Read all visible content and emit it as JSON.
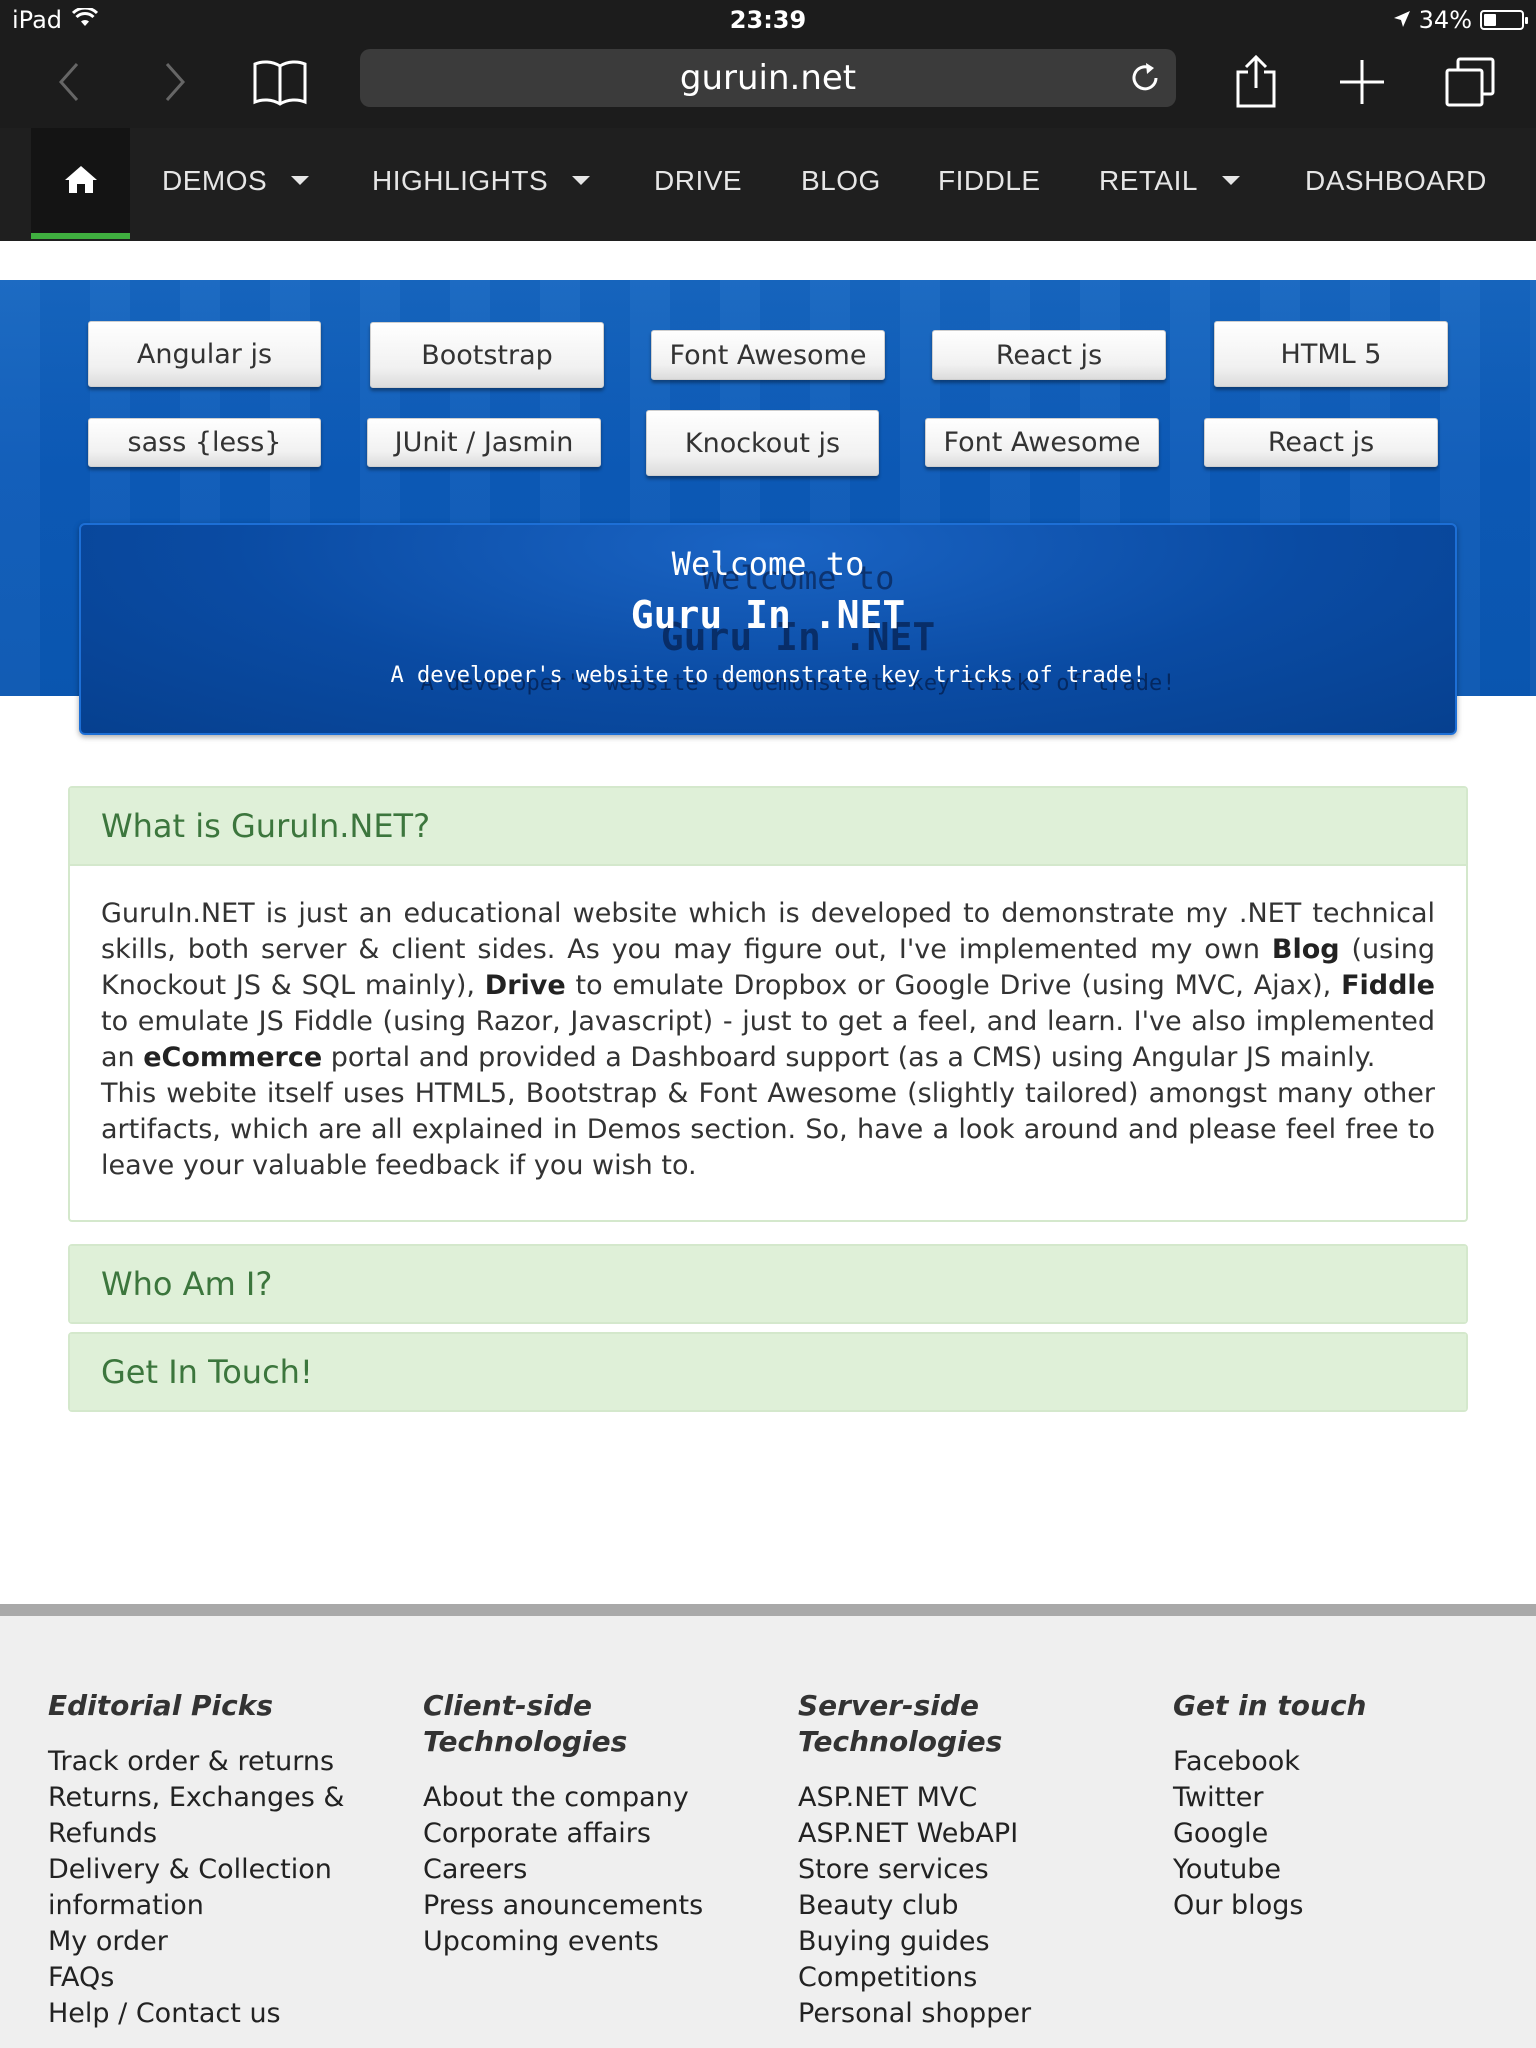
{
  "status_bar": {
    "device": "iPad",
    "time": "23:39",
    "battery": "34%",
    "battery_level": 0.34
  },
  "browser": {
    "url": "guruin.net"
  },
  "nav": {
    "items": [
      {
        "label": "DEMOS",
        "dropdown": true
      },
      {
        "label": "HIGHLIGHTS",
        "dropdown": true
      },
      {
        "label": "DRIVE",
        "dropdown": false
      },
      {
        "label": "BLOG",
        "dropdown": false
      },
      {
        "label": "FIDDLE",
        "dropdown": false
      },
      {
        "label": "RETAIL",
        "dropdown": true
      },
      {
        "label": "DASHBOARD",
        "dropdown": false
      }
    ],
    "active_color": "#3fae3f"
  },
  "tech_buttons": {
    "row1": [
      "Angular js",
      "Bootstrap",
      "Font Awesome",
      "React js",
      "HTML 5"
    ],
    "row2": [
      "sass {less}",
      "JUnit / Jasmin",
      "Knockout js",
      "Font Awesome",
      "React js"
    ]
  },
  "welcome": {
    "line1": "Welcome to",
    "line2": "Guru In .NET",
    "tagline": "A developer's website to demonstrate key tricks of trade!"
  },
  "accordion": {
    "what": {
      "title": "What is GuruIn.NET?",
      "p1_a": "GuruIn.NET is just an educational website which is developed to demonstrate my .NET technical skills, both server & client sides. As you may figure out, I've implemented my own ",
      "p1_blog": "Blog",
      "p1_b": " (using Knockout JS & SQL mainly), ",
      "p1_drive": "Drive",
      "p1_c": " to emulate Dropbox or Google Drive (using MVC, Ajax), ",
      "p1_fiddle": "Fiddle",
      "p1_d": " to emulate JS Fiddle (using Razor, Javascript) - just to get a feel, and learn. I've also implemented an ",
      "p1_ecommerce": "eCommerce",
      "p1_e": " portal and provided a Dashboard support (as a CMS) using Angular JS mainly.",
      "p2": "This webite itself uses HTML5, Bootstrap & Font Awesome (slightly tailored) amongst many other artifacts, which are all explained in Demos section. So, have a look around and please feel free to leave your valuable feedback if you wish to."
    },
    "who": {
      "title": "Who Am I?"
    },
    "touch": {
      "title": "Get In Touch!"
    }
  },
  "footer": {
    "col1": {
      "title": "Editorial Picks",
      "items": [
        "Track order & returns",
        "Returns, Exchanges &",
        "Refunds",
        "Delivery & Collection",
        "information",
        "My order",
        "FAQs",
        "Help / Contact us"
      ]
    },
    "col2": {
      "title_a": "Client-side",
      "title_b": "Technologies",
      "items": [
        "About the company",
        "Corporate affairs",
        "Careers",
        "Press anouncements",
        "Upcoming events"
      ]
    },
    "col3": {
      "title_a": "Server-side",
      "title_b": "Technologies",
      "items": [
        "ASP.NET MVC",
        "ASP.NET WebAPI",
        "Store services",
        "Beauty club",
        "Buying guides",
        "Competitions",
        "Personal shopper"
      ]
    },
    "col4": {
      "title": "Get in touch",
      "items": [
        "Facebook",
        "Twitter",
        "Google",
        "Youtube",
        "Our blogs"
      ]
    }
  },
  "icons": {
    "status": [
      "wifi-icon",
      "location-arrow-icon",
      "battery-icon"
    ],
    "browser": [
      "back-icon",
      "forward-icon",
      "bookmarks-icon",
      "reload-icon",
      "share-icon",
      "new-tab-icon",
      "tabs-icon"
    ],
    "nav": [
      "home-icon",
      "caret-down-icon"
    ]
  }
}
